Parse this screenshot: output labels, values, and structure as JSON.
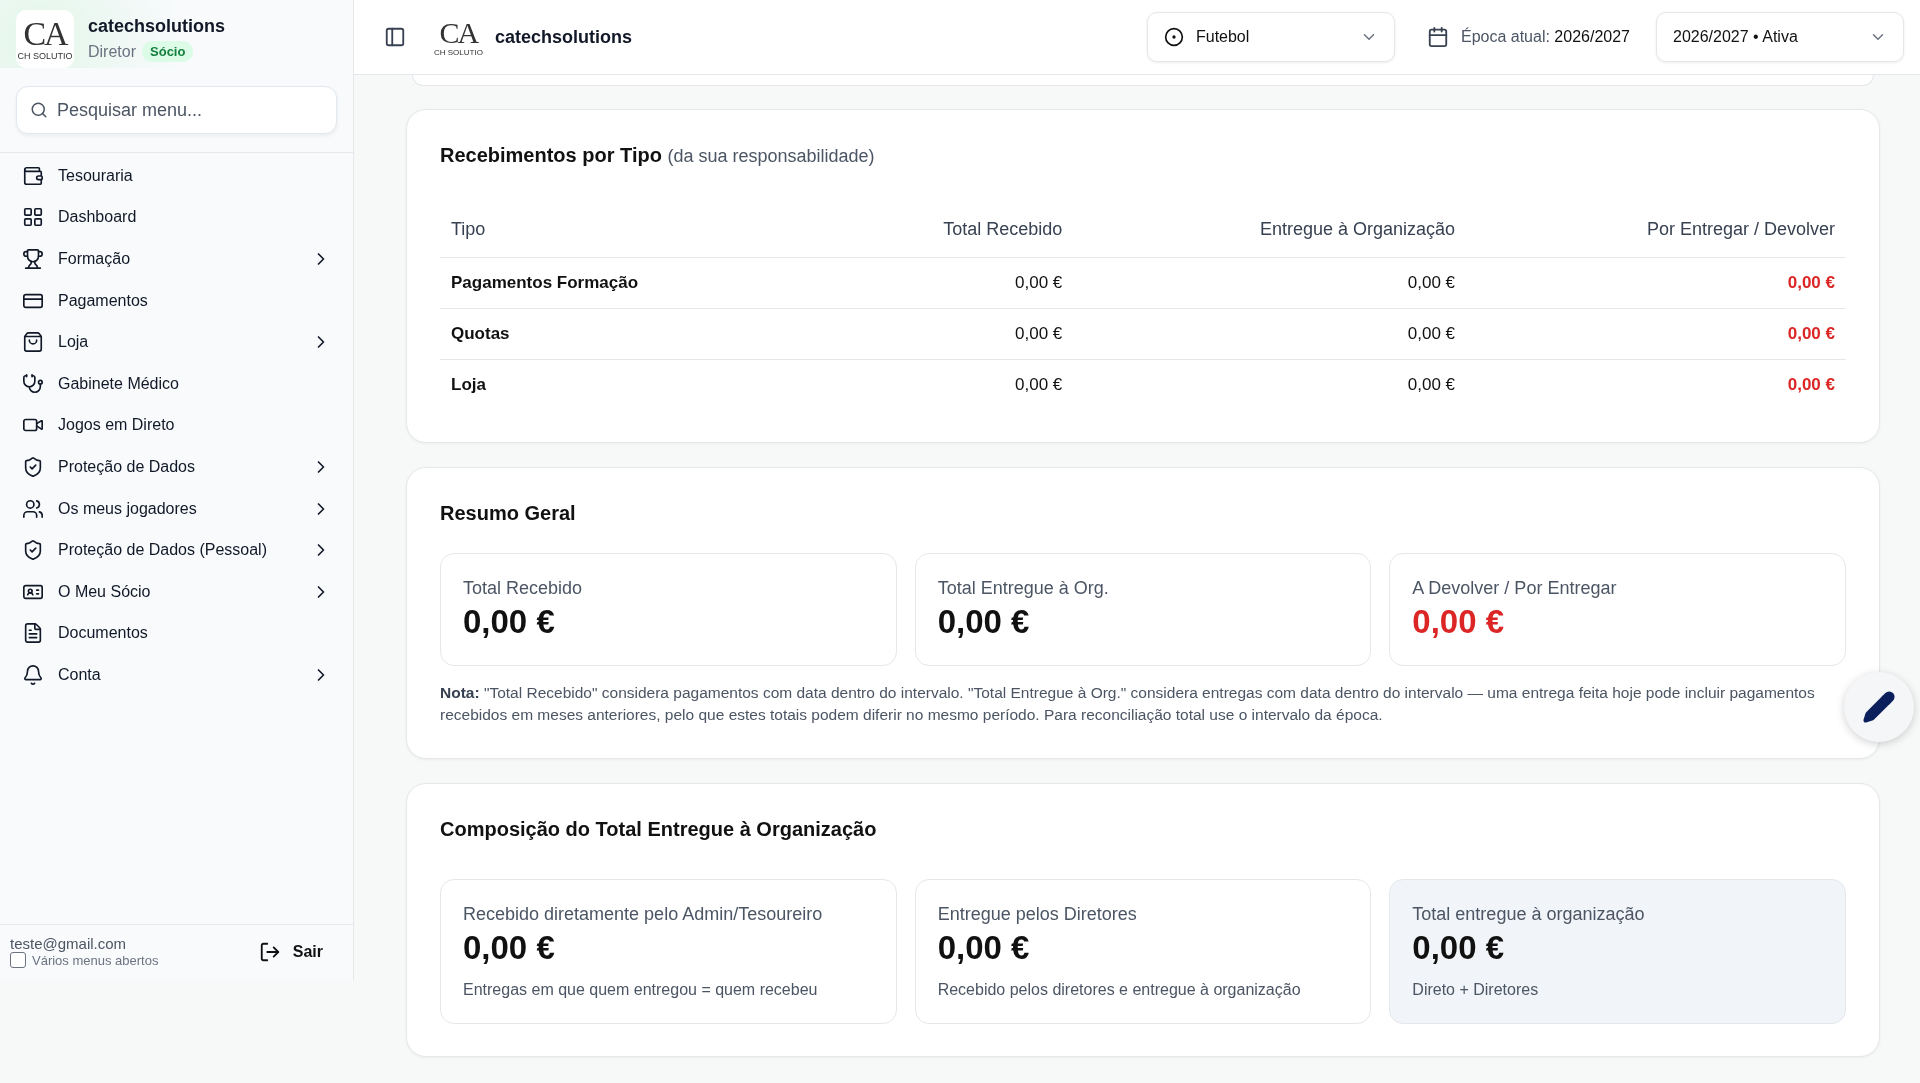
{
  "sidebar": {
    "logo": {
      "mark": "CA",
      "sub": "CH SOLUTIO"
    },
    "org_name": "catechsolutions",
    "role": "Diretor",
    "badge": "Sócio",
    "search": {
      "placeholder": "Pesquisar menu..."
    },
    "items": [
      {
        "label": "Tesouraria",
        "expandable": false
      },
      {
        "label": "Dashboard",
        "expandable": false
      },
      {
        "label": "Formação",
        "expandable": true
      },
      {
        "label": "Pagamentos",
        "expandable": false
      },
      {
        "label": "Loja",
        "expandable": true
      },
      {
        "label": "Gabinete Médico",
        "expandable": false
      },
      {
        "label": "Jogos em Direto",
        "expandable": false
      },
      {
        "label": "Proteção de Dados",
        "expandable": true
      },
      {
        "label": "Os meus jogadores",
        "expandable": true
      },
      {
        "label": "Proteção de Dados (Pessoal)",
        "expandable": true
      },
      {
        "label": "O Meu Sócio",
        "expandable": true
      },
      {
        "label": "Documentos",
        "expandable": false
      },
      {
        "label": "Conta",
        "expandable": true
      }
    ],
    "footer": {
      "email": "teste@gmail.com",
      "multi_menu": {
        "label": "Vários menus abertos",
        "checked": false
      },
      "logout": "Sair"
    }
  },
  "header": {
    "logo": {
      "mark": "CA",
      "sub": "CH SOLUTIO"
    },
    "org_name": "catechsolutions",
    "sport_select": "Futebol",
    "season_label": "Época atual: **2026/2027**",
    "season_select": "2026/2027 • Ativa"
  },
  "receipts_card": {
    "title": "Recebimentos por Tipo",
    "subtitle": "(da sua responsabilidade)",
    "columns": [
      "Tipo",
      "Total Recebido",
      "Entregue à Organização",
      "Por Entregar / Devolver"
    ],
    "rows": [
      [
        "Pagamentos Formação",
        "0,00 €",
        "0,00 €",
        "0,00 €"
      ],
      [
        "Quotas",
        "0,00 €",
        "0,00 €",
        "0,00 €"
      ],
      [
        "Loja",
        "0,00 €",
        "0,00 €",
        "0,00 €"
      ]
    ]
  },
  "summary_card": {
    "title": "Resumo Geral",
    "metrics": [
      {
        "label": "Total Recebido",
        "value": "0,00 €",
        "negative": false
      },
      {
        "label": "Total Entregue à Org.",
        "value": "0,00 €",
        "negative": false
      },
      {
        "label": "A Devolver / Por Entregar",
        "value": "0,00 €",
        "negative": true
      }
    ],
    "note": "**Nota:** \"Total Recebido\" considera pagamentos com data dentro do intervalo. \"Total Entregue à Org.\" considera entregas com data dentro do intervalo — uma entrega feita hoje pode incluir pagamentos recebidos em meses anteriores, pelo que estes totais podem diferir no mesmo período. Para reconciliação total use o intervalo da época."
  },
  "composition_card": {
    "title": "Composição do Total Entregue à Organização",
    "metrics": [
      {
        "label": "Recebido diretamente pelo Admin/Tesoureiro",
        "value": "0,00 €",
        "caption": "Entregas em que quem entregou = quem recebeu",
        "highlight": false
      },
      {
        "label": "Entregue pelos Diretores",
        "value": "0,00 €",
        "caption": "Recebido pelos diretores e entregue à organização",
        "highlight": false
      },
      {
        "label": "Total entregue à organização",
        "value": "0,00 €",
        "caption": "Direto + Diretores",
        "highlight": true
      }
    ]
  }
}
